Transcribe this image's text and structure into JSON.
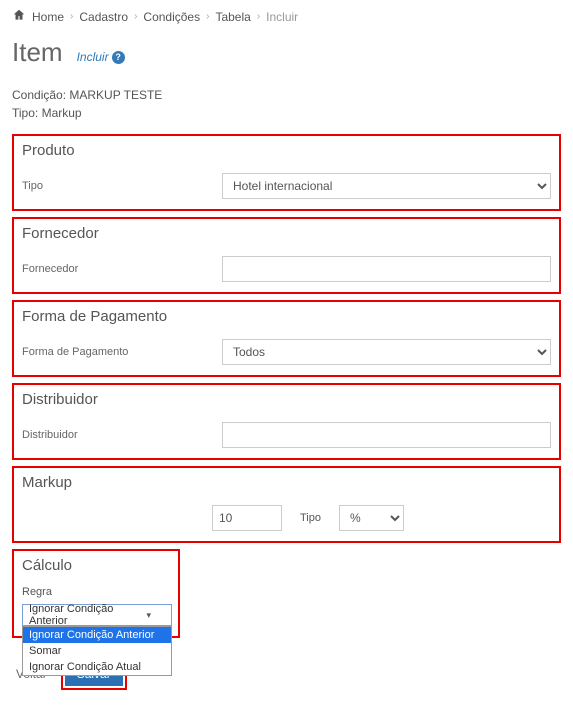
{
  "breadcrumb": {
    "items": [
      "Home",
      "Cadastro",
      "Condições",
      "Tabela",
      "Incluir"
    ]
  },
  "page": {
    "title": "Item",
    "subtitle": "Incluir"
  },
  "info": {
    "condicao_label": "Condição:",
    "condicao_value": "MARKUP TESTE",
    "tipo_label": "Tipo:",
    "tipo_value": "Markup"
  },
  "produto": {
    "title": "Produto",
    "tipo_label": "Tipo",
    "tipo_value": "Hotel internacional"
  },
  "fornecedor": {
    "title": "Fornecedor",
    "label": "Fornecedor",
    "value": ""
  },
  "pagamento": {
    "title": "Forma de Pagamento",
    "label": "Forma de Pagamento",
    "value": "Todos"
  },
  "distribuidor": {
    "title": "Distribuidor",
    "label": "Distribuidor",
    "value": ""
  },
  "markup": {
    "title": "Markup",
    "value": "10",
    "tipo_label": "Tipo",
    "tipo_value": "%"
  },
  "calculo": {
    "title": "Cálculo",
    "regra_label": "Regra",
    "selected": "Ignorar Condição Anterior",
    "options": [
      "Ignorar Condição Anterior",
      "Somar",
      "Ignorar Condição Atual"
    ]
  },
  "footer": {
    "voltar": "Voltar",
    "salvar": "Salvar"
  }
}
